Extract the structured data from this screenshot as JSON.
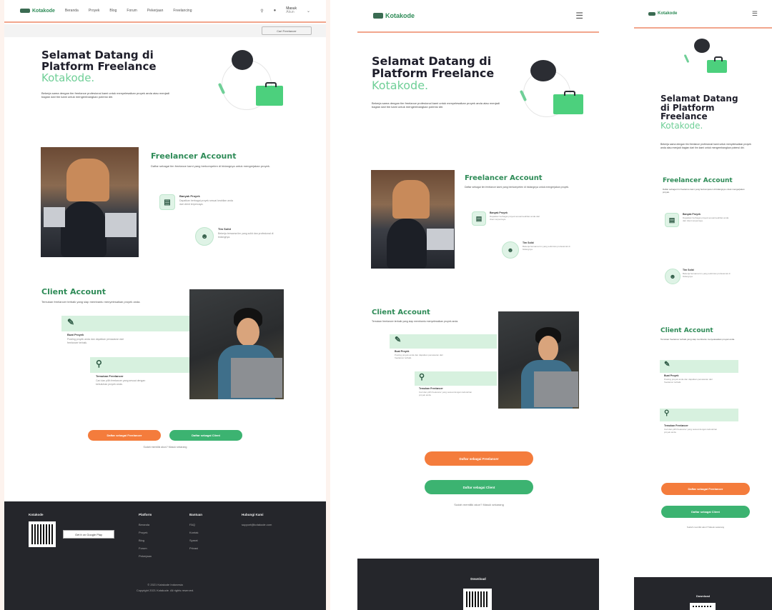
{
  "brand": {
    "name": "Kotakode"
  },
  "nav": {
    "links": [
      "Beranda",
      "Proyek",
      "Blog",
      "Forum",
      "Pekerjaan",
      "Freelancing"
    ],
    "account": "Masuk",
    "account_sub": "Akun",
    "cta": "Cari Freelancer"
  },
  "hero": {
    "title_lines": [
      "Selamat Datang di",
      "Platform Freelance"
    ],
    "title_mobile": [
      "Selamat Datang",
      "di Platform",
      "Freelance"
    ],
    "accent": "Kotakode.",
    "desc": "Bekerja sama dengan tim freelance profesional kami untuk menyelesaikan proyek anda atau menjadi bagian dari tim kami untuk mengembangkan potensi diri."
  },
  "freelancer": {
    "title": "Freelancer Account",
    "title_mobile": "Freelancer Account",
    "desc": "Daftar sebagai tim freelance kami yang berkompeten di bidangnya untuk mengerjakan proyek.",
    "features": [
      {
        "icon": "document-icon",
        "title": "Banyak Proyek",
        "desc": "Dapatkan berbagai proyek sesuai keahlian anda dari client terpercaya."
      },
      {
        "icon": "support-icon",
        "title": "Tim Solid",
        "desc": "Bekerja bersama tim yang solid dan profesional di bidangnya."
      }
    ]
  },
  "client": {
    "title": "Client Account",
    "desc": "Temukan freelancer terbaik yang siap membantu menyelesaikan proyek anda.",
    "features": [
      {
        "icon": "edit-icon",
        "title": "Buat Proyek",
        "desc": "Posting proyek anda dan dapatkan penawaran dari freelancer terbaik."
      },
      {
        "icon": "search-icon",
        "title": "Temukan Freelancer",
        "desc": "Cari dan pilih freelancer yang sesuai dengan kebutuhan proyek anda."
      }
    ]
  },
  "cta": {
    "orange": "Daftar sebagai Freelancer",
    "green": "Daftar sebagai Client",
    "note": "Sudah memiliki akun? Masuk sekarang"
  },
  "footer": {
    "brand": "Kotakode",
    "download": "Download",
    "columns": [
      {
        "title": "Platform",
        "items": [
          "Beranda",
          "Proyek",
          "Blog",
          "Forum",
          "Pekerjaan"
        ]
      },
      {
        "title": "Bantuan",
        "items": [
          "FAQ",
          "Kontak",
          "Syarat",
          "Privasi"
        ]
      },
      {
        "title": "Hubungi Kami",
        "items": [
          "support@kotakode.com"
        ]
      }
    ],
    "legal": [
      "© 2021 Kotakode Indonesia",
      "Copyright 2021 Kotakode. All rights reserved."
    ],
    "qr_badge": "Get it on Google Play"
  }
}
